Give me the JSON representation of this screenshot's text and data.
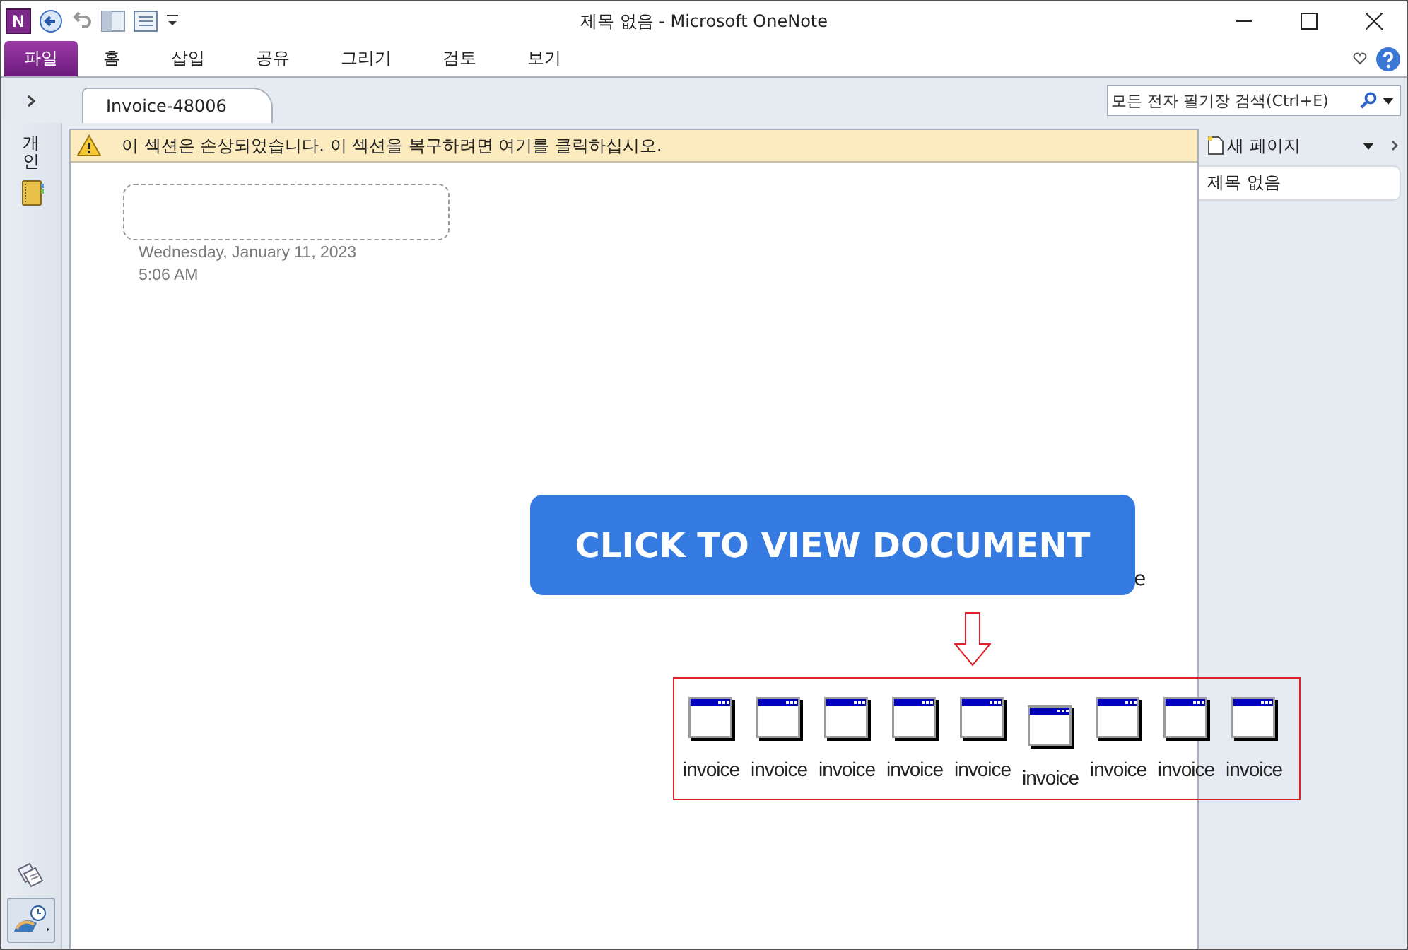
{
  "window": {
    "logo": "N",
    "title": "제목 없음 - Microsoft OneNote"
  },
  "ribbon_tabs": [
    {
      "label": "파일",
      "selected": true
    },
    {
      "label": "홈",
      "selected": false
    },
    {
      "label": "삽입",
      "selected": false
    },
    {
      "label": "공유",
      "selected": false
    },
    {
      "label": "그리기",
      "selected": false
    },
    {
      "label": "검토",
      "selected": false
    },
    {
      "label": "보기",
      "selected": false
    }
  ],
  "section_tabs": [
    {
      "label": "Invoice-48006",
      "selected": true
    }
  ],
  "search": {
    "placeholder": "모든 전자 필기장 검색(Ctrl+E)"
  },
  "nav": {
    "label": "개인"
  },
  "warning": "이 섹션은 손상되었습니다. 이 섹션을 복구하려면 여기를 클릭하십시오.",
  "page": {
    "date": "Wednesday, January 11, 2023",
    "time": "5:06 AM",
    "button": "CLICK TO VIEW DOCUMENT",
    "fragment": "e",
    "attachments": [
      {
        "label": "invoice",
        "lowered": false
      },
      {
        "label": "invoice",
        "lowered": false
      },
      {
        "label": "invoice",
        "lowered": false
      },
      {
        "label": "invoice",
        "lowered": false
      },
      {
        "label": "invoice",
        "lowered": false
      },
      {
        "label": "invoice",
        "lowered": true
      },
      {
        "label": "invoice",
        "lowered": false
      },
      {
        "label": "invoice",
        "lowered": false
      },
      {
        "label": "invoice",
        "lowered": false
      }
    ]
  },
  "pages": {
    "new_page": "새 페이지",
    "items": [
      {
        "title": "제목 없음",
        "selected": true
      }
    ]
  }
}
